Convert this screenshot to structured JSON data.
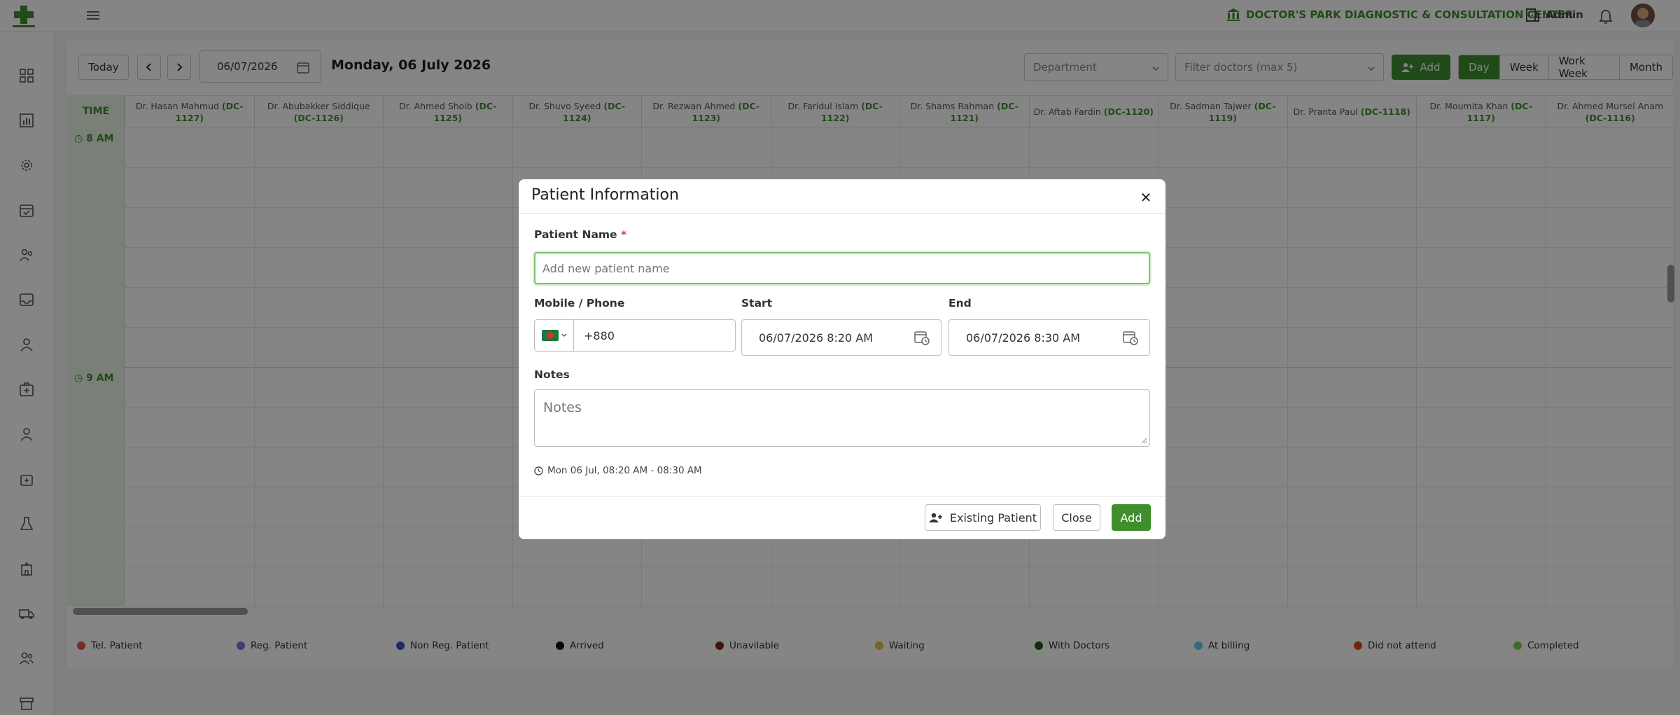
{
  "header": {
    "center_name": "DOCTOR'S PARK DIAGNOSTIC & CONSULTATION CENTER",
    "user_name": "Admin"
  },
  "toolbar": {
    "today_label": "Today",
    "date_value": "06/07/2026",
    "date_title": "Monday, 06 July 2026",
    "department_placeholder": "Department",
    "doctor_filter_placeholder": "Filter doctors (max 5)",
    "add_label": "Add",
    "views": [
      "Day",
      "Week",
      "Work Week",
      "Month"
    ],
    "active_view": "Day"
  },
  "calendar": {
    "time_header": "TIME",
    "time_labels": [
      "8 AM",
      "9 AM"
    ],
    "doctors": [
      {
        "name": "Dr. Hasan Mahmud",
        "code": "(DC-1127)"
      },
      {
        "name": "Dr. Abubakker Siddique",
        "code": "(DC-1126)"
      },
      {
        "name": "Dr. Ahmed Shoib",
        "code": "(DC-1125)"
      },
      {
        "name": "Dr. Shuvo Syeed",
        "code": "(DC-1124)"
      },
      {
        "name": "Dr. Rezwan Ahmed",
        "code": "(DC-1123)"
      },
      {
        "name": "Dr. Faridul Islam",
        "code": "(DC-1122)"
      },
      {
        "name": "Dr. Shams Rahman",
        "code": "(DC-1121)"
      },
      {
        "name": "Dr. Aftab Fardin",
        "code": "(DC-1120)"
      },
      {
        "name": "Dr. Sadman Tajwer",
        "code": "(DC-1119)"
      },
      {
        "name": "Dr. Pranta Paul",
        "code": "(DC-1118)"
      },
      {
        "name": "Dr. Moumita Khan",
        "code": "(DC-1117)"
      },
      {
        "name": "Dr. Ahmed Mursel Anam",
        "code": "(DC-1116)"
      }
    ]
  },
  "legend": [
    {
      "label": "Tel. Patient",
      "color": "#e8574a"
    },
    {
      "label": "Reg. Patient",
      "color": "#8a6be6"
    },
    {
      "label": "Non Reg. Patient",
      "color": "#3a4fc9"
    },
    {
      "label": "Arrived",
      "color": "#111111"
    },
    {
      "label": "Unavilable",
      "color": "#7a2a12"
    },
    {
      "label": "Waiting",
      "color": "#e6c23a"
    },
    {
      "label": "With Doctors",
      "color": "#1f5a14"
    },
    {
      "label": "At billing",
      "color": "#5ad0e6"
    },
    {
      "label": "Did not attend",
      "color": "#e0441e"
    },
    {
      "label": "Completed",
      "color": "#7ad14a"
    }
  ],
  "modal": {
    "title": "Patient Information",
    "patient_name_label": "Patient Name",
    "required_mark": "*",
    "patient_name_placeholder": "Add new patient name",
    "phone_label": "Mobile / Phone",
    "phone_value": "+880",
    "start_label": "Start",
    "start_value": "06/07/2026 8:20 AM",
    "end_label": "End",
    "end_value": "06/07/2026 8:30 AM",
    "notes_label": "Notes",
    "notes_placeholder": "Notes",
    "summary": "Mon 06 Jul, 08:20 AM - 08:30 AM",
    "existing_patient_label": "Existing Patient",
    "close_label": "Close",
    "add_label": "Add"
  }
}
